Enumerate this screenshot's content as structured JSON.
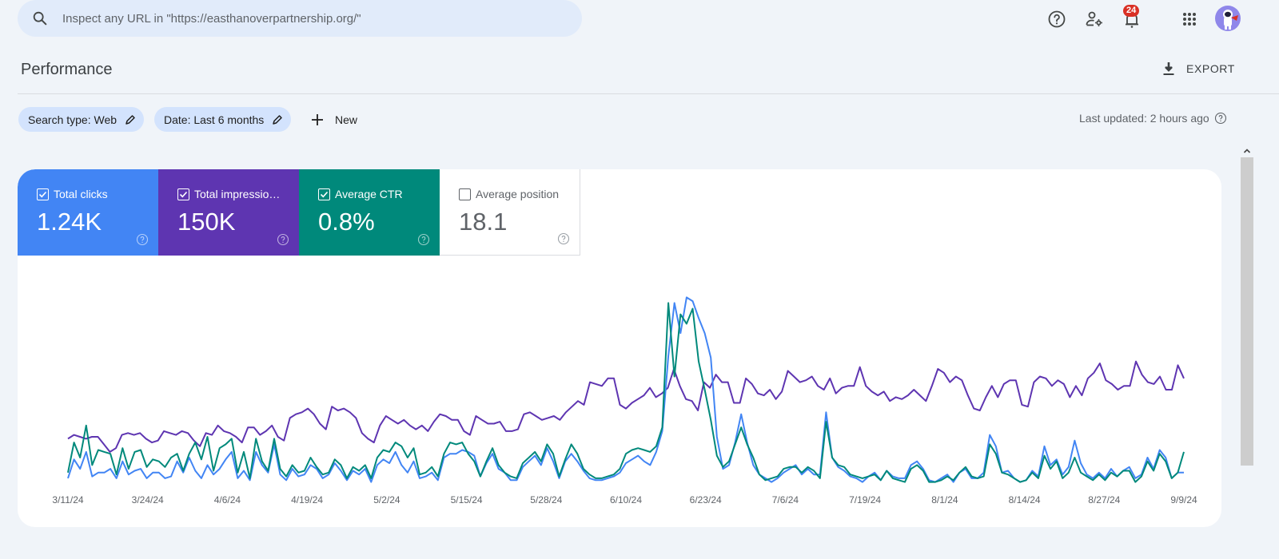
{
  "search": {
    "placeholder": "Inspect any URL in \"https://easthanoverpartnership.org/\"",
    "icon": "search-icon"
  },
  "topbar": {
    "help_icon": "help-circle-icon",
    "users_settings_icon": "manage-users-icon",
    "notifications_icon": "bell-icon",
    "notifications_count": "24",
    "apps_icon": "apps-grid-icon",
    "avatar_icon": "astronaut-avatar"
  },
  "header": {
    "title": "Performance",
    "export_label": "EXPORT"
  },
  "filters": {
    "chips": [
      {
        "label": "Search type: Web"
      },
      {
        "label": "Date: Last 6 months"
      }
    ],
    "new_label": "New",
    "last_updated": "Last updated: 2 hours ago"
  },
  "metrics": [
    {
      "label": "Total clicks",
      "value": "1.24K",
      "checked": true,
      "color": "#4285f4"
    },
    {
      "label": "Total impressio…",
      "value": "150K",
      "checked": true,
      "color": "#5e35b1"
    },
    {
      "label": "Average CTR",
      "value": "0.8%",
      "checked": true,
      "color": "#00897b"
    },
    {
      "label": "Average position",
      "value": "18.1",
      "checked": false,
      "color": "#ffffff"
    }
  ],
  "chart_data": {
    "type": "line",
    "title": "",
    "xlabel": "",
    "ylabel": "",
    "note": "Each series uses its own hidden y-axis; values are relative levels (0-100) of each series' axis range.",
    "x_start": "3/11/24",
    "x_end": "9/9/24",
    "x_tick_labels": [
      "3/11/24",
      "3/24/24",
      "4/6/24",
      "4/19/24",
      "5/2/24",
      "5/15/24",
      "5/28/24",
      "6/10/24",
      "6/23/24",
      "7/6/24",
      "7/19/24",
      "8/1/24",
      "8/14/24",
      "8/27/24",
      "9/9/24"
    ],
    "ylim": [
      0,
      100
    ],
    "grid": false,
    "legend": "metric-cards-top-left",
    "series": [
      {
        "name": "Total impressions",
        "color": "#5e35b1",
        "values": [
          24,
          26,
          25,
          24,
          25,
          25,
          21,
          17,
          19,
          26,
          27,
          26,
          27,
          24,
          22,
          23,
          28,
          27,
          26,
          28,
          27,
          23,
          20,
          27,
          26,
          31,
          28,
          27,
          25,
          22,
          30,
          30,
          26,
          28,
          31,
          25,
          23,
          35,
          37,
          38,
          40,
          37,
          32,
          29,
          41,
          39,
          40,
          38,
          35,
          27,
          24,
          22,
          31,
          36,
          34,
          32,
          34,
          31,
          29,
          31,
          28,
          33,
          37,
          36,
          34,
          34,
          28,
          26,
          36,
          34,
          32,
          32,
          33,
          28,
          28,
          29,
          37,
          38,
          36,
          34,
          35,
          36,
          34,
          38,
          41,
          44,
          42,
          54,
          53,
          52,
          56,
          56,
          42,
          40,
          43,
          45,
          47,
          51,
          46,
          48,
          51,
          61,
          52,
          45,
          44,
          39,
          54,
          51,
          58,
          54,
          54,
          43,
          43,
          56,
          53,
          48,
          47,
          50,
          45,
          49,
          60,
          57,
          54,
          55,
          57,
          52,
          50,
          56,
          48,
          51,
          52,
          52,
          62,
          52,
          49,
          47,
          49,
          44,
          46,
          45,
          47,
          50,
          47,
          44,
          52,
          61,
          59,
          54,
          57,
          55,
          47,
          40,
          39,
          46,
          52,
          46,
          53,
          55,
          55,
          42,
          41,
          54,
          57,
          56,
          52,
          55,
          53,
          46,
          52,
          47,
          56,
          59,
          64,
          55,
          53,
          50,
          52,
          52,
          65,
          58,
          54,
          53,
          57,
          50,
          50,
          63,
          56
        ]
      },
      {
        "name": "Total clicks",
        "color": "#4285f4",
        "values": [
          3,
          13,
          8,
          17,
          4,
          6,
          6,
          8,
          3,
          12,
          5,
          7,
          8,
          3,
          6,
          6,
          3,
          4,
          12,
          6,
          14,
          7,
          3,
          10,
          5,
          8,
          13,
          17,
          3,
          7,
          2,
          17,
          10,
          6,
          21,
          5,
          2,
          8,
          4,
          5,
          10,
          8,
          3,
          5,
          11,
          7,
          2,
          7,
          5,
          8,
          1,
          10,
          13,
          11,
          17,
          10,
          6,
          12,
          3,
          4,
          6,
          2,
          14,
          16,
          16,
          18,
          17,
          15,
          4,
          11,
          16,
          8,
          6,
          2,
          2,
          9,
          12,
          15,
          10,
          19,
          12,
          3,
          12,
          16,
          12,
          7,
          3,
          2,
          2,
          3,
          4,
          6,
          11,
          13,
          15,
          12,
          10,
          17,
          28,
          68,
          96,
          80,
          99,
          97,
          88,
          80,
          67,
          25,
          8,
          10,
          22,
          37,
          22,
          10,
          5,
          3,
          1,
          3,
          6,
          8,
          10,
          5,
          8,
          5,
          5,
          38,
          14,
          9,
          7,
          4,
          3,
          1,
          4,
          6,
          2,
          7,
          4,
          3,
          3,
          10,
          12,
          8,
          2,
          1,
          3,
          5,
          1,
          6,
          8,
          3,
          3,
          6,
          26,
          20,
          6,
          7,
          3,
          1,
          2,
          7,
          4,
          20,
          10,
          13,
          5,
          9,
          23,
          11,
          5,
          3,
          6,
          3,
          8,
          4,
          7,
          9,
          3,
          5,
          14,
          8,
          18,
          14,
          3,
          6,
          6
        ]
      },
      {
        "name": "Average CTR",
        "color": "#00897b",
        "values": [
          6,
          22,
          14,
          31,
          10,
          18,
          17,
          16,
          5,
          19,
          8,
          17,
          18,
          9,
          13,
          12,
          9,
          14,
          16,
          7,
          16,
          22,
          13,
          25,
          7,
          19,
          21,
          24,
          6,
          17,
          3,
          24,
          12,
          7,
          24,
          8,
          4,
          10,
          6,
          7,
          14,
          9,
          5,
          6,
          13,
          10,
          3,
          9,
          7,
          10,
          3,
          14,
          18,
          17,
          22,
          20,
          14,
          19,
          5,
          6,
          9,
          4,
          16,
          22,
          21,
          22,
          16,
          12,
          4,
          12,
          19,
          10,
          6,
          4,
          3,
          11,
          14,
          17,
          12,
          21,
          16,
          4,
          13,
          21,
          16,
          8,
          5,
          3,
          3,
          4,
          5,
          8,
          16,
          18,
          19,
          18,
          17,
          20,
          30,
          96,
          57,
          90,
          85,
          93,
          65,
          50,
          34,
          15,
          9,
          12,
          21,
          30,
          21,
          14,
          5,
          2,
          3,
          4,
          8,
          9,
          9,
          6,
          9,
          7,
          3,
          33,
          14,
          10,
          9,
          5,
          4,
          3,
          4,
          5,
          2,
          7,
          3,
          2,
          1,
          8,
          10,
          7,
          1,
          1,
          2,
          4,
          2,
          6,
          9,
          4,
          3,
          4,
          21,
          16,
          6,
          5,
          3,
          1,
          2,
          6,
          3,
          15,
          8,
          12,
          3,
          6,
          14,
          6,
          4,
          2,
          5,
          2,
          6,
          4,
          7,
          7,
          1,
          4,
          12,
          7,
          16,
          12,
          3,
          6,
          17
        ]
      }
    ]
  }
}
